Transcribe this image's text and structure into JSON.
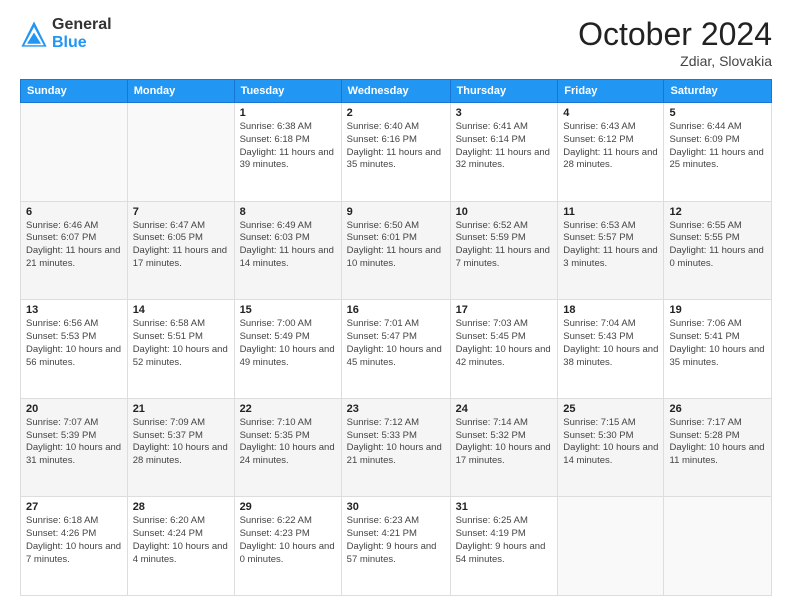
{
  "logo": {
    "general": "General",
    "blue": "Blue"
  },
  "header": {
    "month": "October 2024",
    "location": "Zdiar, Slovakia"
  },
  "weekdays": [
    "Sunday",
    "Monday",
    "Tuesday",
    "Wednesday",
    "Thursday",
    "Friday",
    "Saturday"
  ],
  "weeks": [
    [
      {
        "day": "",
        "info": ""
      },
      {
        "day": "",
        "info": ""
      },
      {
        "day": "1",
        "info": "Sunrise: 6:38 AM\nSunset: 6:18 PM\nDaylight: 11 hours and 39 minutes."
      },
      {
        "day": "2",
        "info": "Sunrise: 6:40 AM\nSunset: 6:16 PM\nDaylight: 11 hours and 35 minutes."
      },
      {
        "day": "3",
        "info": "Sunrise: 6:41 AM\nSunset: 6:14 PM\nDaylight: 11 hours and 32 minutes."
      },
      {
        "day": "4",
        "info": "Sunrise: 6:43 AM\nSunset: 6:12 PM\nDaylight: 11 hours and 28 minutes."
      },
      {
        "day": "5",
        "info": "Sunrise: 6:44 AM\nSunset: 6:09 PM\nDaylight: 11 hours and 25 minutes."
      }
    ],
    [
      {
        "day": "6",
        "info": "Sunrise: 6:46 AM\nSunset: 6:07 PM\nDaylight: 11 hours and 21 minutes."
      },
      {
        "day": "7",
        "info": "Sunrise: 6:47 AM\nSunset: 6:05 PM\nDaylight: 11 hours and 17 minutes."
      },
      {
        "day": "8",
        "info": "Sunrise: 6:49 AM\nSunset: 6:03 PM\nDaylight: 11 hours and 14 minutes."
      },
      {
        "day": "9",
        "info": "Sunrise: 6:50 AM\nSunset: 6:01 PM\nDaylight: 11 hours and 10 minutes."
      },
      {
        "day": "10",
        "info": "Sunrise: 6:52 AM\nSunset: 5:59 PM\nDaylight: 11 hours and 7 minutes."
      },
      {
        "day": "11",
        "info": "Sunrise: 6:53 AM\nSunset: 5:57 PM\nDaylight: 11 hours and 3 minutes."
      },
      {
        "day": "12",
        "info": "Sunrise: 6:55 AM\nSunset: 5:55 PM\nDaylight: 11 hours and 0 minutes."
      }
    ],
    [
      {
        "day": "13",
        "info": "Sunrise: 6:56 AM\nSunset: 5:53 PM\nDaylight: 10 hours and 56 minutes."
      },
      {
        "day": "14",
        "info": "Sunrise: 6:58 AM\nSunset: 5:51 PM\nDaylight: 10 hours and 52 minutes."
      },
      {
        "day": "15",
        "info": "Sunrise: 7:00 AM\nSunset: 5:49 PM\nDaylight: 10 hours and 49 minutes."
      },
      {
        "day": "16",
        "info": "Sunrise: 7:01 AM\nSunset: 5:47 PM\nDaylight: 10 hours and 45 minutes."
      },
      {
        "day": "17",
        "info": "Sunrise: 7:03 AM\nSunset: 5:45 PM\nDaylight: 10 hours and 42 minutes."
      },
      {
        "day": "18",
        "info": "Sunrise: 7:04 AM\nSunset: 5:43 PM\nDaylight: 10 hours and 38 minutes."
      },
      {
        "day": "19",
        "info": "Sunrise: 7:06 AM\nSunset: 5:41 PM\nDaylight: 10 hours and 35 minutes."
      }
    ],
    [
      {
        "day": "20",
        "info": "Sunrise: 7:07 AM\nSunset: 5:39 PM\nDaylight: 10 hours and 31 minutes."
      },
      {
        "day": "21",
        "info": "Sunrise: 7:09 AM\nSunset: 5:37 PM\nDaylight: 10 hours and 28 minutes."
      },
      {
        "day": "22",
        "info": "Sunrise: 7:10 AM\nSunset: 5:35 PM\nDaylight: 10 hours and 24 minutes."
      },
      {
        "day": "23",
        "info": "Sunrise: 7:12 AM\nSunset: 5:33 PM\nDaylight: 10 hours and 21 minutes."
      },
      {
        "day": "24",
        "info": "Sunrise: 7:14 AM\nSunset: 5:32 PM\nDaylight: 10 hours and 17 minutes."
      },
      {
        "day": "25",
        "info": "Sunrise: 7:15 AM\nSunset: 5:30 PM\nDaylight: 10 hours and 14 minutes."
      },
      {
        "day": "26",
        "info": "Sunrise: 7:17 AM\nSunset: 5:28 PM\nDaylight: 10 hours and 11 minutes."
      }
    ],
    [
      {
        "day": "27",
        "info": "Sunrise: 6:18 AM\nSunset: 4:26 PM\nDaylight: 10 hours and 7 minutes."
      },
      {
        "day": "28",
        "info": "Sunrise: 6:20 AM\nSunset: 4:24 PM\nDaylight: 10 hours and 4 minutes."
      },
      {
        "day": "29",
        "info": "Sunrise: 6:22 AM\nSunset: 4:23 PM\nDaylight: 10 hours and 0 minutes."
      },
      {
        "day": "30",
        "info": "Sunrise: 6:23 AM\nSunset: 4:21 PM\nDaylight: 9 hours and 57 minutes."
      },
      {
        "day": "31",
        "info": "Sunrise: 6:25 AM\nSunset: 4:19 PM\nDaylight: 9 hours and 54 minutes."
      },
      {
        "day": "",
        "info": ""
      },
      {
        "day": "",
        "info": ""
      }
    ]
  ]
}
